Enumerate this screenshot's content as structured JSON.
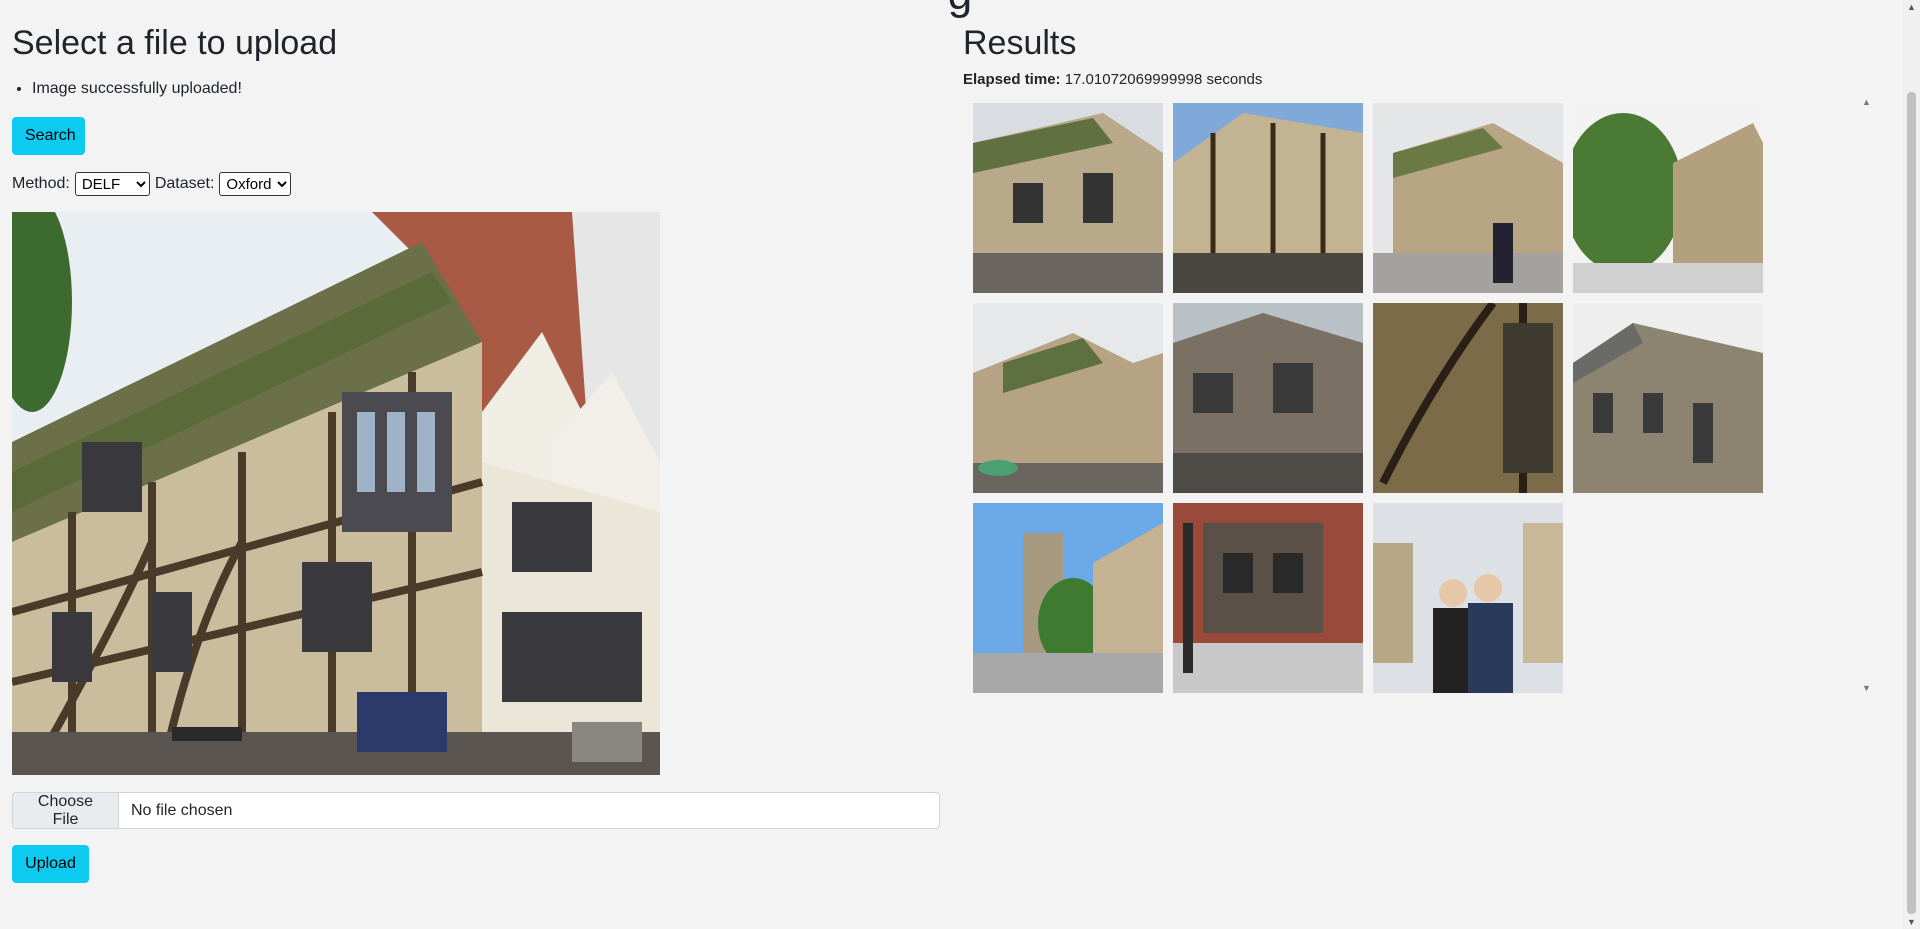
{
  "page": {
    "top_heading_fragment": "g"
  },
  "upload_panel": {
    "title": "Select a file to upload",
    "messages": [
      "Image successfully uploaded!"
    ],
    "search_label": "Search",
    "method_label": "Method:",
    "method_value": "DELF",
    "dataset_label": "Dataset:",
    "dataset_value": "Oxford",
    "query_image_icon": "query-building-photo",
    "choose_file_label": "Choose File",
    "file_status": "No file chosen",
    "upload_label": "Upload"
  },
  "results_panel": {
    "title": "Results",
    "elapsed_label": "Elapsed time:",
    "elapsed_value": "17.01072069999998 seconds",
    "result_count": 11
  },
  "colors": {
    "accent_button": "#0dcaf0",
    "background": "#f3f3f3"
  }
}
